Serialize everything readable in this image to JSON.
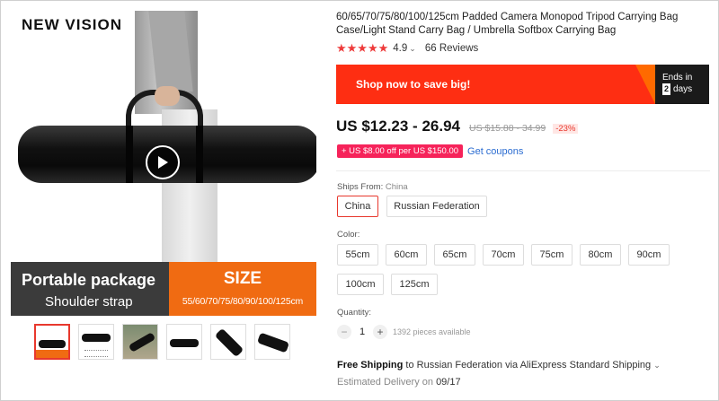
{
  "gallery": {
    "brand": "NEW VISION",
    "banner_left_title": "Portable package",
    "banner_left_sub": "Shoulder strap",
    "banner_right_title": "SIZE",
    "banner_right_sub": "55/60/70/75/80/90/100/125cm",
    "thumbnails": [
      "thumb-1",
      "thumb-2",
      "thumb-3",
      "thumb-4",
      "thumb-5",
      "thumb-6"
    ]
  },
  "product": {
    "title": "60/65/70/75/80/100/125cm Padded Camera Monopod Tripod Carrying Bag Case/Light Stand Carry Bag / Umbrella Softbox Carrying Bag",
    "rating": "4.9",
    "rating_stars": 4.9,
    "reviews": "66 Reviews"
  },
  "promo": {
    "label": "Shop now to save big!",
    "ends_label": "Ends in",
    "days_value": "2",
    "days_unit": "days"
  },
  "price": {
    "current": "US $12.23 - 26.94",
    "original": "US $15.88 - 34.99",
    "discount": "-23%"
  },
  "coupon": {
    "label": "+ US $8.00 off per US $150.00",
    "link": "Get coupons"
  },
  "ships_from": {
    "label": "Ships From:",
    "value": "China",
    "options": [
      "China",
      "Russian Federation"
    ],
    "selected": "China"
  },
  "color": {
    "label": "Color:",
    "options": [
      "55cm",
      "60cm",
      "65cm",
      "70cm",
      "75cm",
      "80cm",
      "90cm",
      "100cm",
      "125cm"
    ]
  },
  "quantity": {
    "label": "Quantity:",
    "value": "1",
    "minus": "−",
    "plus": "+",
    "available": "1392 pieces available"
  },
  "shipping": {
    "free": "Free Shipping",
    "text": "to Russian Federation via AliExpress Standard Shipping",
    "delivery_label": "Estimated Delivery on",
    "delivery_date": "09/17"
  },
  "colors": {
    "accent_red": "#e8382d",
    "promo_red": "#fe2e12",
    "promo_orange": "#ff6a00",
    "coupon_pink": "#f6235a",
    "link_blue": "#2b6cd1",
    "banner_orange": "#f06b12"
  }
}
